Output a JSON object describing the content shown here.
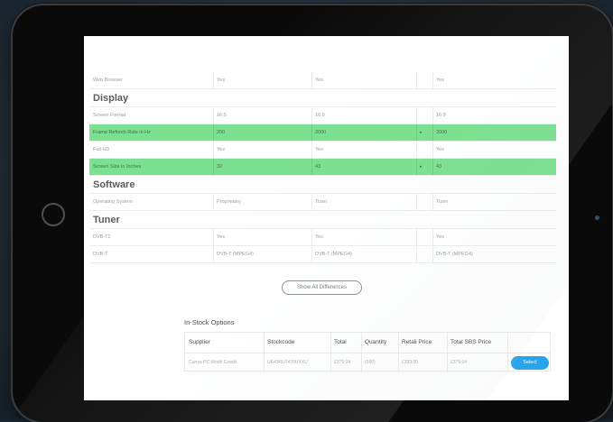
{
  "top_row": {
    "label": "Web Browser",
    "v1": "Yes",
    "v2": "Yes",
    "v3": "Yes"
  },
  "sections": [
    {
      "title": "Display",
      "rows": [
        {
          "label": "Screen Format",
          "v1": "16:9",
          "v2": "16:9",
          "arrow": "",
          "v3": "16:9",
          "highlight": false
        },
        {
          "label": "Frame Refresh Rate in Hz",
          "v1": "200",
          "v2": "2000",
          "arrow": "▸",
          "v3": "2000",
          "highlight": true
        },
        {
          "label": "Full HD",
          "v1": "Yes",
          "v2": "Yes",
          "arrow": "",
          "v3": "Yes",
          "highlight": false
        },
        {
          "label": "Screen Size in Inches",
          "v1": "32",
          "v2": "43",
          "arrow": "▸",
          "v3": "43",
          "highlight": true
        }
      ]
    },
    {
      "title": "Software",
      "rows": [
        {
          "label": "Operating System",
          "v1": "Proprietary",
          "v2": "Tizen",
          "arrow": "",
          "v3": "Tizen",
          "highlight": false
        }
      ]
    },
    {
      "title": "Tuner",
      "rows": [
        {
          "label": "DVB-T2",
          "v1": "Yes",
          "v2": "Yes",
          "arrow": "",
          "v3": "Yes",
          "highlight": false
        },
        {
          "label": "DVB-T",
          "v1": "DVB-T (MPEG4)",
          "v2": "DVB-T (MPEG4)",
          "arrow": "",
          "v3": "DVB-T (MPEG4)",
          "highlight": false
        }
      ]
    }
  ],
  "show_all_differences_label": "Show All Differences",
  "in_stock": {
    "title": "In-Stock Options",
    "headers": [
      "Supplier",
      "Stockcode",
      "Total",
      "Quantity",
      "Retail Price",
      "Total SBS Price"
    ],
    "row": [
      "Currys PC World Goods",
      "UE43RU7470UXXU",
      "£379.04",
      "(500)",
      "£399.00",
      "£379.04"
    ],
    "select_label": "Select"
  },
  "colors": {
    "highlight": "#7be08f",
    "select_button": "#27a4ea"
  }
}
